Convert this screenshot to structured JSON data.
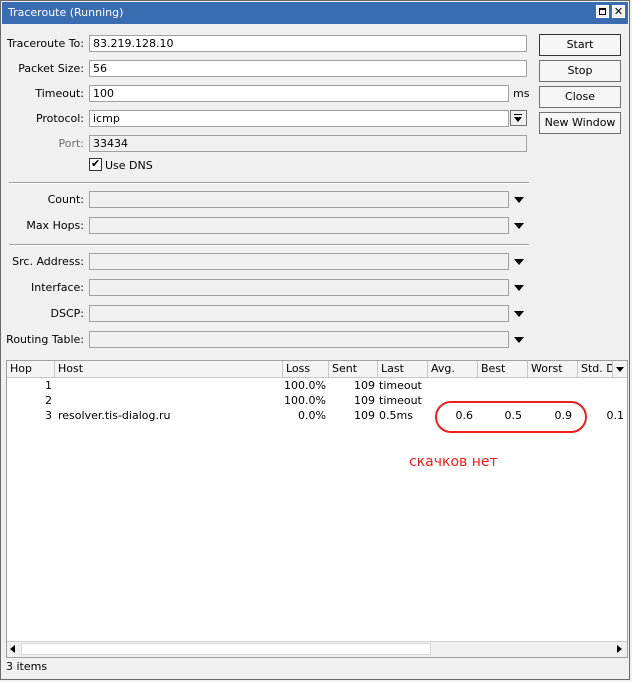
{
  "window": {
    "title": "Traceroute (Running)"
  },
  "form": {
    "traceroute_to": {
      "label": "Traceroute To:",
      "value": "83.219.128.10"
    },
    "packet_size": {
      "label": "Packet Size:",
      "value": "56"
    },
    "timeout": {
      "label": "Timeout:",
      "value": "100",
      "unit": "ms"
    },
    "protocol": {
      "label": "Protocol:",
      "value": "icmp"
    },
    "port": {
      "label": "Port:",
      "value": "33434"
    },
    "use_dns": {
      "label": "Use DNS",
      "checked": true
    },
    "count": {
      "label": "Count:",
      "value": ""
    },
    "max_hops": {
      "label": "Max Hops:",
      "value": ""
    },
    "src_address": {
      "label": "Src. Address:",
      "value": ""
    },
    "interface": {
      "label": "Interface:",
      "value": ""
    },
    "dscp": {
      "label": "DSCP:",
      "value": ""
    },
    "routing_table": {
      "label": "Routing Table:",
      "value": ""
    }
  },
  "buttons": {
    "start": "Start",
    "stop": "Stop",
    "close": "Close",
    "new_window": "New Window"
  },
  "table": {
    "columns": [
      "Hop",
      "Host",
      "Loss",
      "Sent",
      "Last",
      "Avg.",
      "Best",
      "Worst",
      "Std. De"
    ],
    "rows": [
      {
        "hop": "1",
        "host": "",
        "loss": "100.0%",
        "sent": "109",
        "last": "timeout",
        "avg": "",
        "best": "",
        "worst": "",
        "std": ""
      },
      {
        "hop": "2",
        "host": "",
        "loss": "100.0%",
        "sent": "109",
        "last": "timeout",
        "avg": "",
        "best": "",
        "worst": "",
        "std": ""
      },
      {
        "hop": "3",
        "host": "resolver.tis-dialog.ru",
        "loss": "0.0%",
        "sent": "109",
        "last": "0.5ms",
        "avg": "0.6",
        "best": "0.5",
        "worst": "0.9",
        "std": "0.1"
      }
    ]
  },
  "annotation": {
    "text": "скачков нет",
    "color": "#e8201e"
  },
  "status": {
    "items": "3 items"
  },
  "colors": {
    "titlebar": "#3a6cb2"
  }
}
